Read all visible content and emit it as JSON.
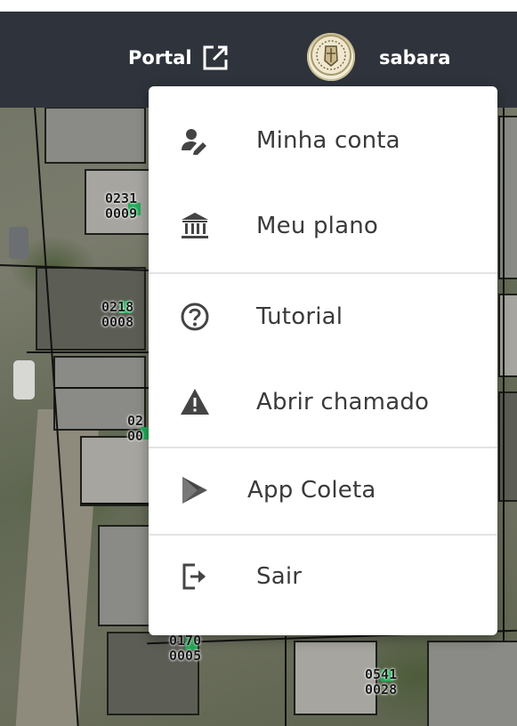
{
  "header": {
    "portal_label": "Portal",
    "portal_icon": "external-link-icon",
    "avatar_icon": "municipal-seal-icon",
    "username": "sabara",
    "background_color": "#2f333b",
    "text_color": "#ffffff"
  },
  "menu": {
    "items": [
      {
        "label": "Minha conta",
        "icon": "user-edit-icon"
      },
      {
        "label": "Meu plano",
        "icon": "bank-building-icon"
      },
      {
        "label": "Tutorial",
        "icon": "help-circle-icon"
      },
      {
        "label": "Abrir chamado",
        "icon": "warning-triangle-icon"
      },
      {
        "label": "App Coleta",
        "icon": "play-store-icon"
      },
      {
        "label": "Sair",
        "icon": "logout-icon"
      }
    ]
  },
  "map": {
    "lot_labels": [
      {
        "line1": "0231",
        "line2": "0009"
      },
      {
        "line1": "0218",
        "line2": "0008"
      },
      {
        "line1": "02",
        "line2": "00"
      },
      {
        "line1": "0170",
        "line2": "0005"
      },
      {
        "line1": "0541",
        "line2": "0028"
      }
    ],
    "pin_color": "#1faa55"
  }
}
